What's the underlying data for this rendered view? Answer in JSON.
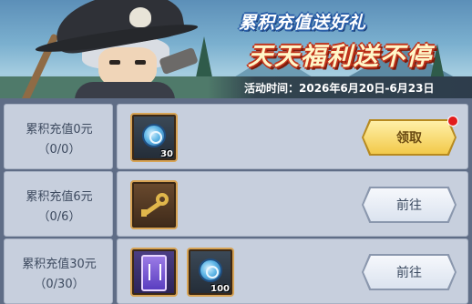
{
  "banner": {
    "title": "累积充值送好礼",
    "slogan": "天天福利送不停",
    "activity_time": "活动时间：2026年6月20日-6月23日"
  },
  "colors": {
    "panel": "#c7cfdd",
    "background": "#5f6d86",
    "slot_border": "#d7a354",
    "claim_button": "#f2c94a",
    "notify_dot": "#e21c1c"
  },
  "rows": [
    {
      "title": "累积充值0元",
      "progress": "（0/0）",
      "rewards": [
        {
          "icon": "blue-coin-icon",
          "qty": "30"
        }
      ],
      "button": "领取",
      "button_state": "claimable",
      "has_notification": true
    },
    {
      "title": "累积充值6元",
      "progress": "（0/6）",
      "rewards": [
        {
          "icon": "golden-key-icon",
          "qty": ""
        }
      ],
      "button": "前往",
      "button_state": "goto",
      "has_notification": false
    },
    {
      "title": "累积充值30元",
      "progress": "（0/30）",
      "rewards": [
        {
          "icon": "purple-card-icon",
          "qty": ""
        },
        {
          "icon": "blue-coin-icon",
          "qty": "100"
        }
      ],
      "button": "前往",
      "button_state": "goto",
      "has_notification": false
    }
  ]
}
